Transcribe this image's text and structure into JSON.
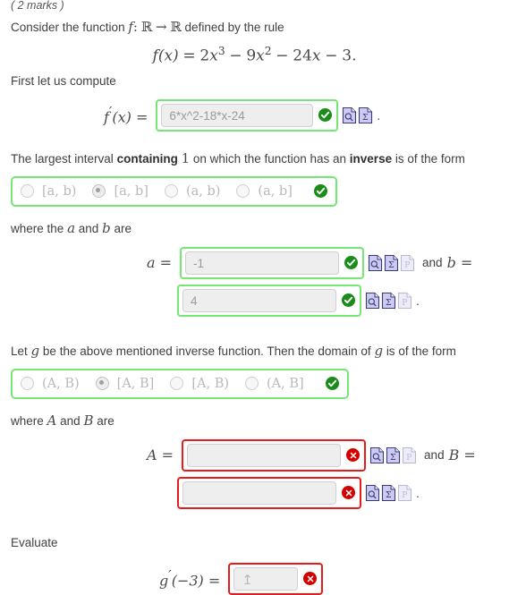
{
  "header": {
    "marks": "( 2 marks )"
  },
  "intro": {
    "line1_a": "Consider the function",
    "line1_f": "f",
    "line1_colon": ":",
    "line1_R1": "ℝ",
    "line1_arrow": "→",
    "line1_R2": "ℝ",
    "line1_b": "defined by the rule",
    "formula": {
      "lhs": "f(x)",
      "eq": "=",
      "t1_coef": "2",
      "t1_var": "x",
      "t1_pow": "3",
      "op1": "−",
      "t2_coef": "9",
      "t2_var": "x",
      "t2_pow": "2",
      "op2": "−",
      "t3_coef": "24",
      "t3_var": "x",
      "op3": "−",
      "t4": "3",
      "end": "."
    },
    "compute_text": "First let us compute"
  },
  "derivative_row": {
    "label_g": "f",
    "label_prime": "′",
    "label_arg": "(x) =",
    "value": "6*x^2-18*x-24",
    "status": "ok",
    "trailing": "."
  },
  "interval_question": {
    "text_a": "The largest interval",
    "bold_a": "containing",
    "number": "1",
    "text_b": "on which the function has an",
    "bold_b": "inverse",
    "text_c": "is of the form",
    "options": [
      {
        "label": "[a, b)",
        "selected": false
      },
      {
        "label": "[a, b]",
        "selected": true
      },
      {
        "label": "(a, b)",
        "selected": false
      },
      {
        "label": "(a, b]",
        "selected": false
      }
    ],
    "status": "ok"
  },
  "ab_section": {
    "prompt_a": "where the",
    "prompt_var1": "a",
    "prompt_and": "and",
    "prompt_var2": "b",
    "prompt_b": "are",
    "a_label": "a =",
    "a_value": "-1",
    "a_status": "ok",
    "and_label": "and",
    "b_label": "b =",
    "b_value": "4",
    "b_status": "ok",
    "trailing": "."
  },
  "domain_question": {
    "text_a": "Let",
    "var_g": "g",
    "text_b": "be the above mentioned inverse function. Then the domain of",
    "var_g2": "g",
    "text_c": "is of the form",
    "options": [
      {
        "label": "(A, B)",
        "selected": false
      },
      {
        "label": "[A, B]",
        "selected": true
      },
      {
        "label": "[A, B)",
        "selected": false
      },
      {
        "label": "(A, B]",
        "selected": false
      }
    ],
    "status": "ok"
  },
  "AB_section": {
    "prompt_a": "where",
    "prompt_var1": "A",
    "prompt_and": "and",
    "prompt_var2": "B",
    "prompt_b": "are",
    "A_label": "A =",
    "A_value": "",
    "A_status": "err",
    "and_label": "and",
    "B_label": "B =",
    "B_value": "",
    "B_status": "err",
    "trailing": "."
  },
  "evaluate_section": {
    "heading": "Evaluate",
    "expr_g": "g",
    "expr_prime": "′",
    "expr_arg": "(−3) =",
    "value": "",
    "caret": "↥",
    "status": "err"
  },
  "icons": {
    "preview": "preview-page-icon",
    "sigma": "sigma-page-icon",
    "plot": "plot-page-icon",
    "ok_badge": "check-circle-icon",
    "err_badge": "error-circle-icon"
  },
  "colors": {
    "ok_border": "#75e775",
    "err_border": "#e81b1b",
    "ok_badge": "#198c19",
    "err_badge": "#d40000",
    "field_bg": "#eeeeee",
    "text": "#3f3f3f"
  }
}
